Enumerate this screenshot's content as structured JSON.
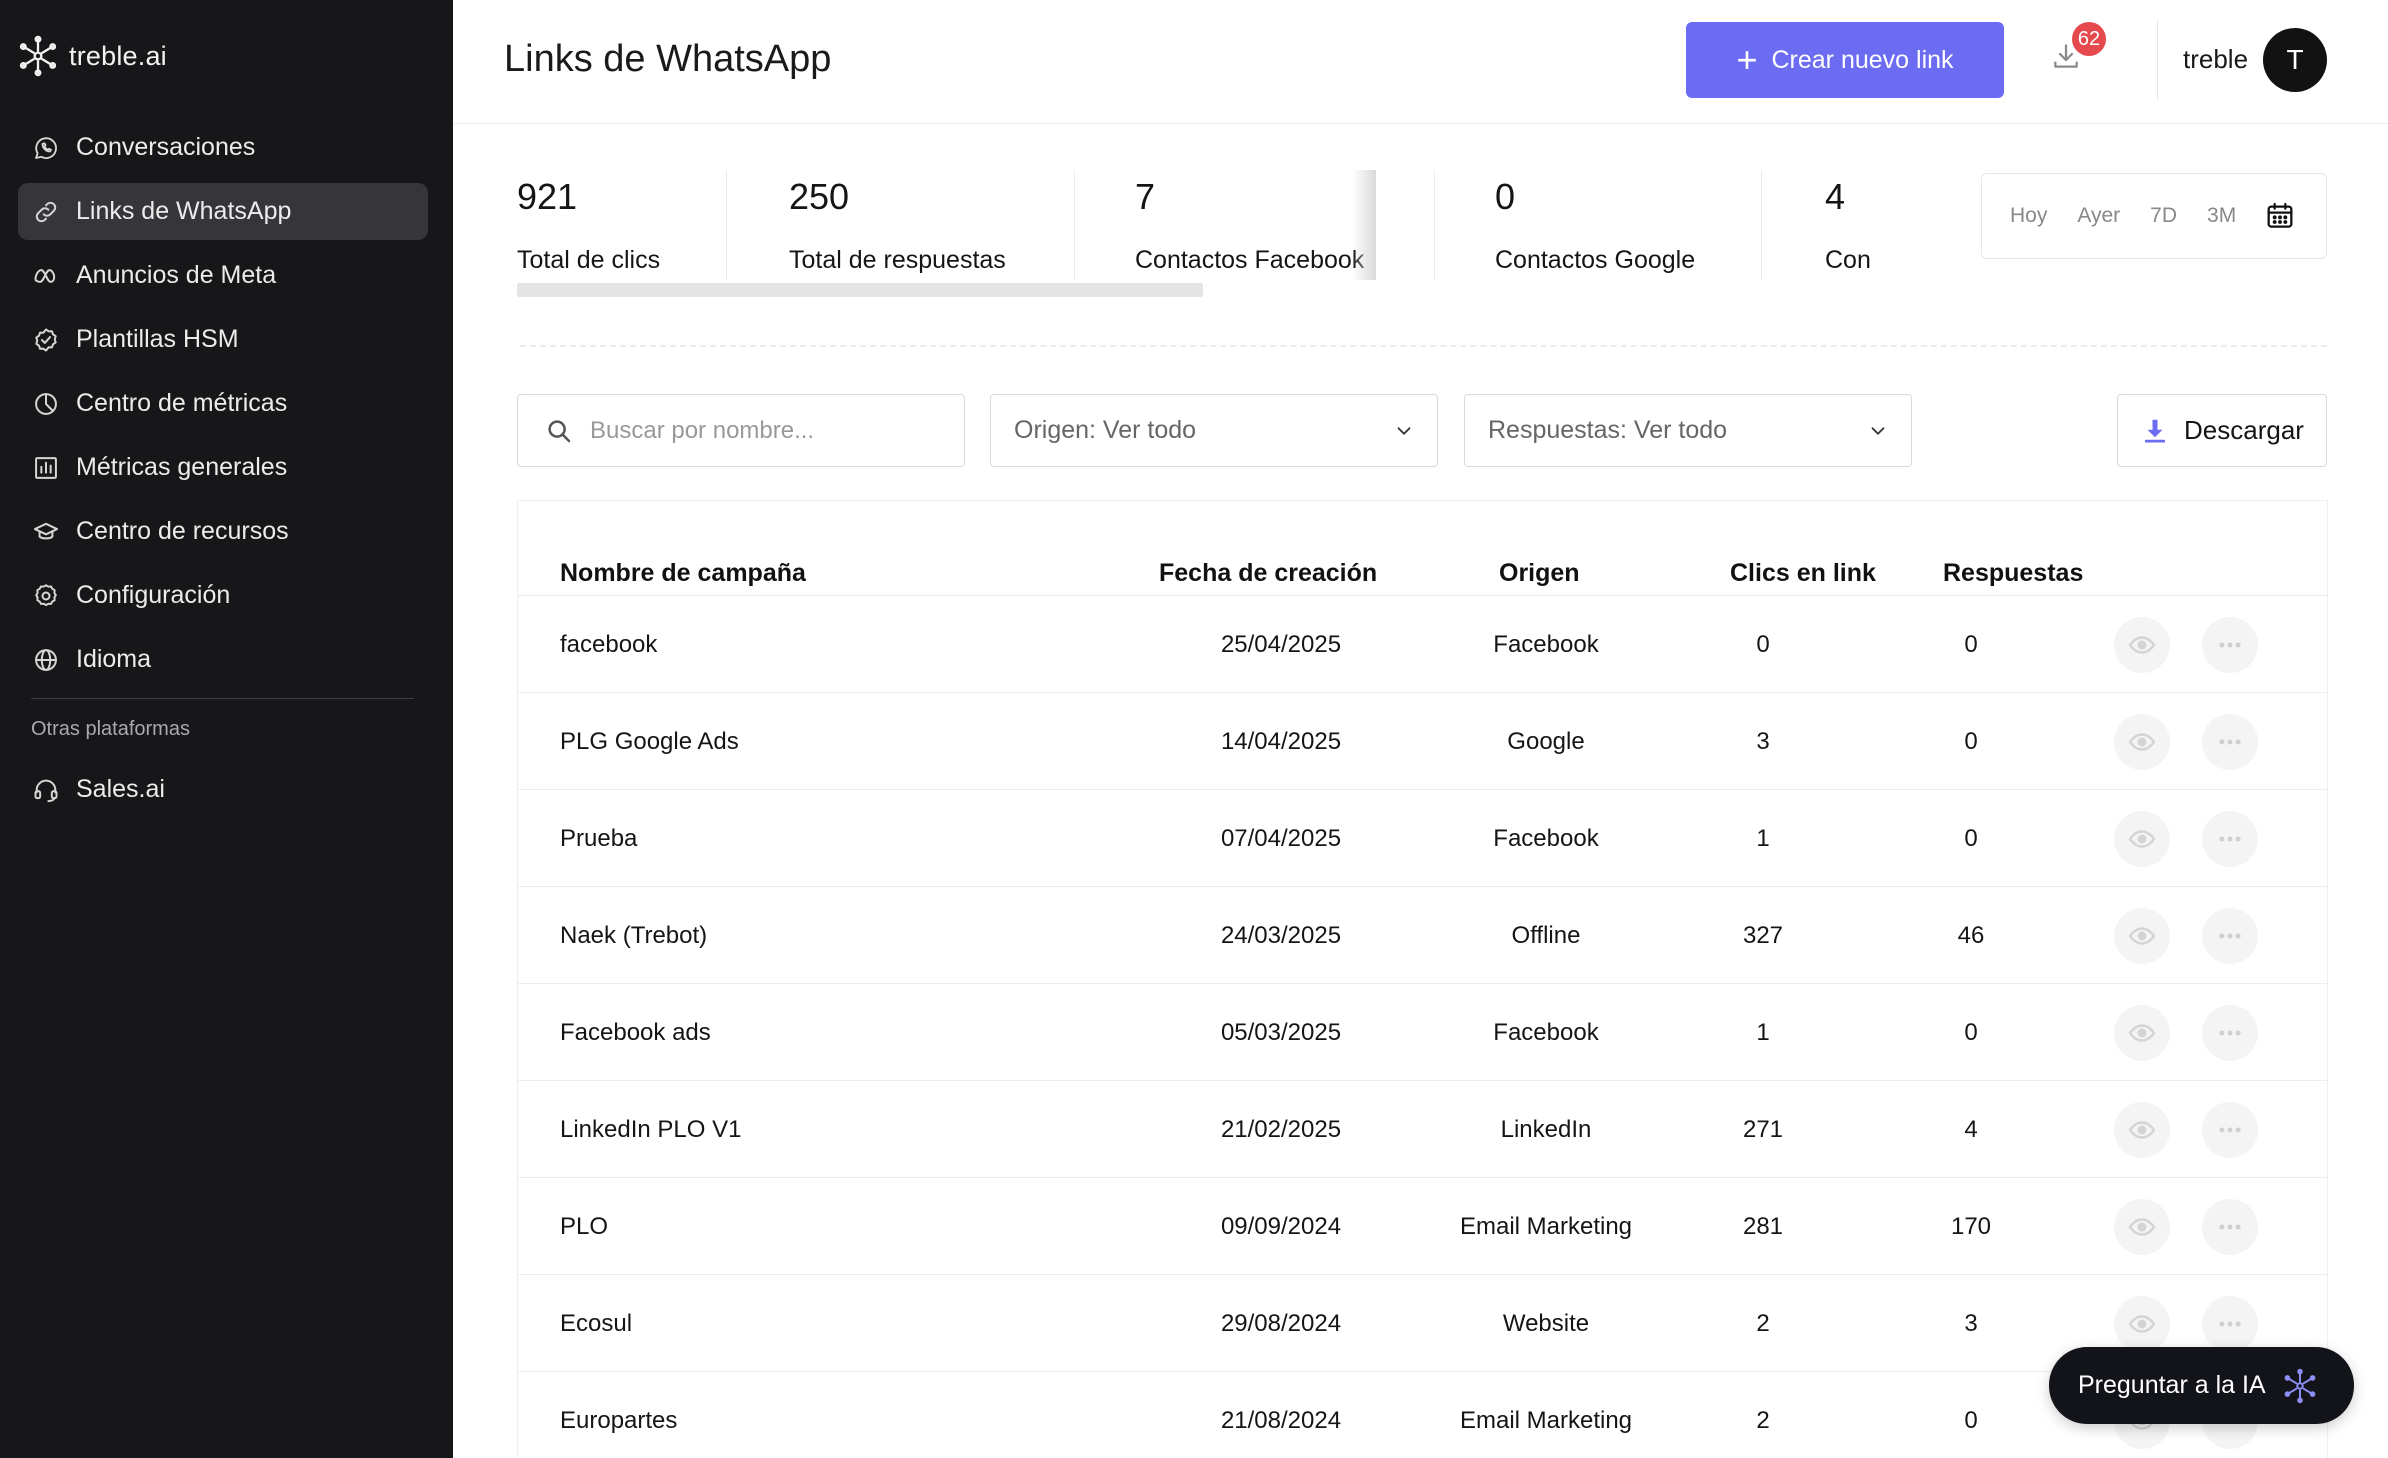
{
  "brand": {
    "name": "treble.ai"
  },
  "sidebar": {
    "items": [
      {
        "label": "Conversaciones",
        "icon": "whatsapp-icon"
      },
      {
        "label": "Links de WhatsApp",
        "icon": "link-icon",
        "active": true
      },
      {
        "label": "Anuncios de Meta",
        "icon": "meta-icon"
      },
      {
        "label": "Plantillas HSM",
        "icon": "badge-check-icon"
      },
      {
        "label": "Centro de métricas",
        "icon": "pie-chart-icon"
      },
      {
        "label": "Métricas generales",
        "icon": "bar-chart-icon"
      },
      {
        "label": "Centro de recursos",
        "icon": "graduation-cap-icon"
      },
      {
        "label": "Configuración",
        "icon": "gear-icon"
      },
      {
        "label": "Idioma",
        "icon": "globe-icon"
      }
    ],
    "section_label": "Otras plataformas",
    "extra": [
      {
        "label": "Sales.ai",
        "icon": "headset-icon"
      }
    ]
  },
  "header": {
    "title": "Links de WhatsApp",
    "create_label": "Crear nuevo link",
    "downloads_badge": "62",
    "user_name": "treble",
    "avatar_initial": "T"
  },
  "stats": [
    {
      "value": "921",
      "label": "Total de clics"
    },
    {
      "value": "250",
      "label": "Total de respuestas"
    },
    {
      "value": "7",
      "label": "Contactos Facebook"
    },
    {
      "value": "0",
      "label": "Contactos Google"
    },
    {
      "value": "4",
      "label": "Con"
    }
  ],
  "period": {
    "options": [
      "Hoy",
      "Ayer",
      "7D",
      "3M"
    ]
  },
  "filters": {
    "search_placeholder": "Buscar por nombre...",
    "origin_label": "Origen: Ver todo",
    "responses_label": "Respuestas: Ver todo",
    "download_label": "Descargar"
  },
  "table": {
    "columns": [
      "Nombre de campaña",
      "Fecha de creación",
      "Origen",
      "Clics en link",
      "Respuestas"
    ],
    "rows": [
      {
        "name": "facebook",
        "date": "25/04/2025",
        "origin": "Facebook",
        "clicks": "0",
        "responses": "0"
      },
      {
        "name": "PLG Google Ads",
        "date": "14/04/2025",
        "origin": "Google",
        "clicks": "3",
        "responses": "0"
      },
      {
        "name": "Prueba",
        "date": "07/04/2025",
        "origin": "Facebook",
        "clicks": "1",
        "responses": "0"
      },
      {
        "name": "Naek (Trebot)",
        "date": "24/03/2025",
        "origin": "Offline",
        "clicks": "327",
        "responses": "46"
      },
      {
        "name": "Facebook ads",
        "date": "05/03/2025",
        "origin": "Facebook",
        "clicks": "1",
        "responses": "0"
      },
      {
        "name": "LinkedIn PLO V1",
        "date": "21/02/2025",
        "origin": "LinkedIn",
        "clicks": "271",
        "responses": "4"
      },
      {
        "name": "PLO",
        "date": "09/09/2024",
        "origin": "Email Marketing",
        "clicks": "281",
        "responses": "170"
      },
      {
        "name": "Ecosul",
        "date": "29/08/2024",
        "origin": "Website",
        "clicks": "2",
        "responses": "3"
      },
      {
        "name": "Europartes",
        "date": "21/08/2024",
        "origin": "Email Marketing",
        "clicks": "2",
        "responses": "0"
      }
    ]
  },
  "ai_button": {
    "label": "Preguntar a la IA"
  },
  "colors": {
    "sidebar_bg": "#17171a",
    "accent": "#6c6cf2",
    "badge": "#e5484d",
    "active_item": "#35353a"
  }
}
